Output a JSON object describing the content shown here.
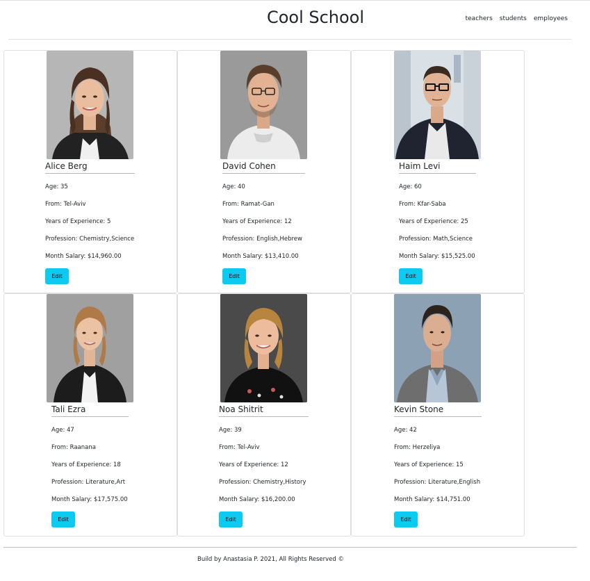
{
  "header": {
    "title": "Cool School",
    "nav": [
      "teachers",
      "students",
      "employees"
    ]
  },
  "cards": [
    {
      "name": "Alice Berg",
      "age": "Age: 35",
      "from": "From: Tel-Aviv",
      "experience": "Years of Experience: 5",
      "profession": "Profession: Chemistry,Science",
      "salary": "Month Salary: $14,960.00",
      "edit": "Edit"
    },
    {
      "name": "David Cohen",
      "age": "Age: 40",
      "from": "From: Ramat-Gan",
      "experience": "Years of Experience: 12",
      "profession": "Profession: English,Hebrew",
      "salary": "Month Salary: $13,410.00",
      "edit": "Edit"
    },
    {
      "name": "Haim Levi",
      "age": "Age: 60",
      "from": "From: Kfar-Saba",
      "experience": "Years of Experience: 25",
      "profession": "Profession: Math,Science",
      "salary": "Month Salary: $15,525.00",
      "edit": "Edit"
    },
    {
      "name": "Tali Ezra",
      "age": "Age: 47",
      "from": "From: Raanana",
      "experience": "Years of Experience: 18",
      "profession": "Profession: Literature,Art",
      "salary": "Month Salary: $17,575.00",
      "edit": "Edit"
    },
    {
      "name": "Noa Shitrit",
      "age": "Age: 39",
      "from": "From: Tel-Aviv",
      "experience": "Years of Experience: 12",
      "profession": "Profession: Chemistry,History",
      "salary": "Month Salary: $16,200.00",
      "edit": "Edit"
    },
    {
      "name": "Kevin Stone",
      "age": "Age: 42",
      "from": "From: Herzeliya",
      "experience": "Years of Experience: 15",
      "profession": "Profession: Literature,English",
      "salary": "Month Salary: $14,751.00",
      "edit": "Edit"
    }
  ],
  "footer": {
    "text": "Build by Anastasia P. 2021, All Rights Reserved ©"
  },
  "colors": {
    "accent": "#0dcaf0",
    "text": "#212529",
    "border": "#dfdfdf"
  }
}
